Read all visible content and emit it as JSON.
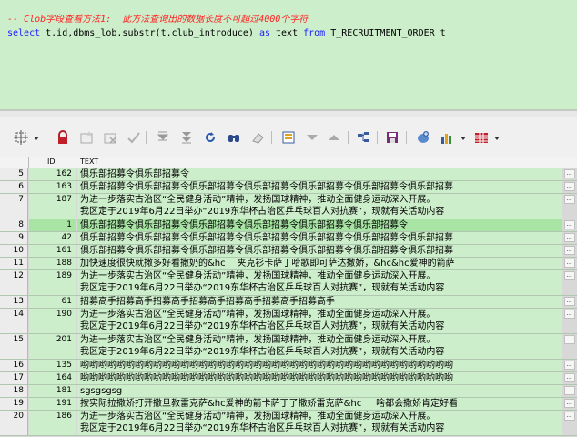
{
  "editor": {
    "comment": "-- Clob字段查看方法1:  此方法查询出的数据长度不可超过4000个字符",
    "sql_select": "select",
    "sql_cols": " t.id,dbms_lob.substr(t.club_introduce) ",
    "sql_as": "as",
    "sql_alias": " text ",
    "sql_from": "from",
    "sql_table": " T_RECRUITMENT_ORDER t"
  },
  "toolbar": {
    "icons": [
      "grid-select-icon",
      "lock-icon",
      "new-record-icon",
      "delete-record-icon",
      "post-check-icon",
      "fetch-next-icon",
      "fetch-all-icon",
      "refresh-icon",
      "find-icon",
      "clear-icon",
      "single-record-view-icon",
      "sort-down-icon",
      "sort-up-icon",
      "query-by-example-icon",
      "save-icon",
      "export-icon",
      "chart-icon",
      "table-options-icon"
    ]
  },
  "grid": {
    "columns": {
      "id": "ID",
      "text": "TEXT"
    },
    "rows": [
      {
        "num": "5",
        "id": "162",
        "text": "俱乐部招募令俱乐部招募令",
        "lines": 1
      },
      {
        "num": "6",
        "id": "163",
        "text": "俱乐部招募令俱乐部招募令俱乐部招募令俱乐部招募令俱乐部招募令俱乐部招募令俱乐部招募",
        "lines": 1
      },
      {
        "num": "7",
        "id": "187",
        "text": "为进一步落实古治区“全民健身活动”精神，发扬国球精神，推动全面健身运动深入开展。\n我区定于2019年6月22日举办“2019东华杯古治区乒乓球百人对抗赛”，现就有关活动内容",
        "lines": 2
      },
      {
        "num": "8",
        "id": "1",
        "text": "俱乐部招募令俱乐部招募令俱乐部招募令俱乐部招募令俱乐部招募令俱乐部招募令",
        "lines": 1,
        "selected": true
      },
      {
        "num": "9",
        "id": "42",
        "text": "俱乐部招募令俱乐部招募令俱乐部招募令俱乐部招募令俱乐部招募令俱乐部招募令俱乐部招募",
        "lines": 1
      },
      {
        "num": "10",
        "id": "161",
        "text": "俱乐部招募令俱乐部招募令俱乐部招募令俱乐部招募令俱乐部招募令俱乐部招募令俱乐部招募",
        "lines": 1
      },
      {
        "num": "11",
        "id": "188",
        "text": "加快速度很快就撒多好看撒奶的&hc    夹克衫卡萨丁哈歌即可萨达撒娇，&hc&hc爱神的箭萨",
        "lines": 1
      },
      {
        "num": "12",
        "id": "189",
        "text": "为进一步落实古治区“全民健身活动”精神，发扬国球精神，推动全面健身运动深入开展。\n我区定于2019年6月22日举办“2019东华杯古治区乒乓球百人对抗赛”，现就有关活动内容",
        "lines": 2
      },
      {
        "num": "13",
        "id": "61",
        "text": "招募高手招募高手招募高手招募高手招募高手招募高手招募高手",
        "lines": 1
      },
      {
        "num": "14",
        "id": "190",
        "text": "为进一步落实古治区“全民健身活动”精神，发扬国球精神，推动全面健身运动深入开展。\n我区定于2019年6月22日举办“2019东华杯古治区乒乓球百人对抗赛”，现就有关活动内容",
        "lines": 2
      },
      {
        "num": "15",
        "id": "201",
        "text": "为进一步落实古治区“全民健身活动”精神，发扬国球精神，推动全面健身运动深入开展。\n我区定于2019年6月22日举办“2019东华杯古治区乒乓球百人对抗赛”，现就有关活动内容",
        "lines": 2
      },
      {
        "num": "16",
        "id": "135",
        "text": "哟哟哟哟哟哟哟哟哟哟哟哟哟哟哟哟哟哟哟哟哟哟哟哟哟哟哟哟哟哟哟哟哟哟哟哟哟哟哟哟哟",
        "lines": 1
      },
      {
        "num": "17",
        "id": "164",
        "text": "哟哟哟哟哟哟哟哟哟哟哟哟哟哟哟哟哟哟哟哟哟哟哟哟哟哟哟哟哟哟哟哟哟哟哟哟哟哟哟哟哟",
        "lines": 1
      },
      {
        "num": "18",
        "id": "181",
        "text": "sgsgsgsg",
        "lines": 1
      },
      {
        "num": "19",
        "id": "191",
        "text": "按实际拉撒娇打开撒旦教雷克萨&hc爱神的箭卡萨丁了撒娇雷克萨&hc     啥都会撒娇肯定好看",
        "lines": 1
      },
      {
        "num": "20",
        "id": "186",
        "text": "为进一步落实古治区“全民健身活动”精神，发扬国球精神，推动全面健身运动深入开展。\n我区定于2019年6月22日举办“2019东华杯古治区乒乓球百人对抗赛”，现就有关活动内容",
        "lines": 2
      }
    ],
    "cell_button": "..."
  }
}
